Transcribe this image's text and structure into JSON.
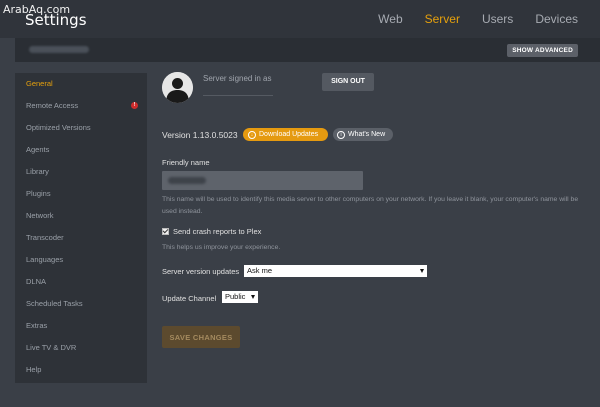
{
  "watermark": "ArabAq.com",
  "header": {
    "title": "Settings",
    "nav": [
      {
        "label": "Web",
        "active": false
      },
      {
        "label": "Server",
        "active": true
      },
      {
        "label": "Users",
        "active": false
      },
      {
        "label": "Devices",
        "active": false
      }
    ]
  },
  "subheader": {
    "show_advanced_label": "SHOW ADVANCED"
  },
  "sidebar": {
    "items": [
      {
        "label": "General",
        "active": true
      },
      {
        "label": "Remote Access",
        "badge": "!"
      },
      {
        "label": "Optimized Versions"
      },
      {
        "label": "Agents"
      },
      {
        "label": "Library"
      },
      {
        "label": "Plugins"
      },
      {
        "label": "Network"
      },
      {
        "label": "Transcoder"
      },
      {
        "label": "Languages"
      },
      {
        "label": "DLNA"
      },
      {
        "label": "Scheduled Tasks"
      },
      {
        "label": "Extras"
      },
      {
        "label": "Live TV & DVR"
      },
      {
        "label": "Help"
      }
    ]
  },
  "account": {
    "signed_in_label": "Server signed in as",
    "sign_out_label": "SIGN OUT",
    "avatar_icon": "user-silhouette-icon"
  },
  "version": {
    "label": "Version 1.13.0.5023",
    "download_label": "Download Updates",
    "whats_new_label": "What's New"
  },
  "form": {
    "friendly_name_label": "Friendly name",
    "friendly_name_help": "This name will be used to identify this media server to other computers on your network. If you leave it blank, your computer's name will be used instead.",
    "crash_reports_label": "Send crash reports to Plex",
    "crash_reports_checked": true,
    "crash_reports_help": "This helps us improve your experience.",
    "server_version_updates_label": "Server version updates",
    "server_version_updates_value": "Ask me",
    "update_channel_label": "Update Channel",
    "update_channel_value": "Public",
    "save_label": "SAVE CHANGES"
  },
  "colors": {
    "accent": "#e5a00d",
    "background": "#3a3f47",
    "sidebar": "#2e3238",
    "badge": "#cc2c2c"
  }
}
